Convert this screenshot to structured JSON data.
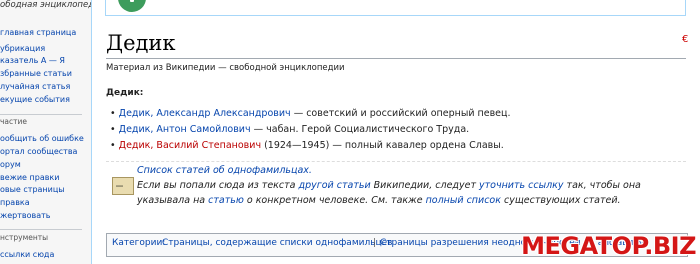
{
  "sidebar": {
    "tagline": "ободная энциклопедия",
    "nav": [
      "главная страница",
      "убрикация",
      "казатель А — Я",
      "збранные статьи",
      "лучайная статья",
      "екущие события"
    ],
    "participation_heading": "частие",
    "participation": [
      "ообщить об ошибке",
      "ортал сообщества",
      "орум",
      "вежие правки",
      "овые страницы",
      "правка",
      "жертвовать"
    ],
    "tools_heading": "нструменты",
    "tools": [
      "ссылки сюда"
    ]
  },
  "article": {
    "title": "Дедик",
    "flag_icon": "€",
    "site_sub": "Материал из Википедии — свободной энциклопедии",
    "lead": "Дедик:",
    "items": [
      {
        "bullet": "•",
        "name": "Дедик, Александр Александрович",
        "desc": " — советский и российский оперный певец.",
        "is_new": false
      },
      {
        "bullet": "•",
        "name": "Дедик, Антон Самойлович",
        "desc": " — чабан. Герой Социалистического Труда.",
        "is_new": false
      },
      {
        "bullet": "•",
        "name": "Дедик, Василий Степанович",
        "desc": " (1924—1945) — полный кавалер ордена Славы.",
        "is_new": true
      }
    ]
  },
  "disambig": {
    "icon_text": "―",
    "title": "Список статей об однофамильцах.",
    "t1": "Если вы попали сюда из текста ",
    "l1": "другой статьи",
    "t2": " Википедии, следует ",
    "l2": "уточнить ссылку",
    "t3": " так, чтобы она указывала на ",
    "l3": "статью",
    "t4": " о конкретном человеке. См. также ",
    "l4": "полный список",
    "t5": " существующих статей."
  },
  "categories": {
    "label": "Категории:",
    "items": [
      "Страницы, содержащие списки однофамильцев",
      "Страницы разрешения неоднозначностей по алфавиту"
    ],
    "sep": "|"
  },
  "watermark": "MEGATOP.BIZ"
}
